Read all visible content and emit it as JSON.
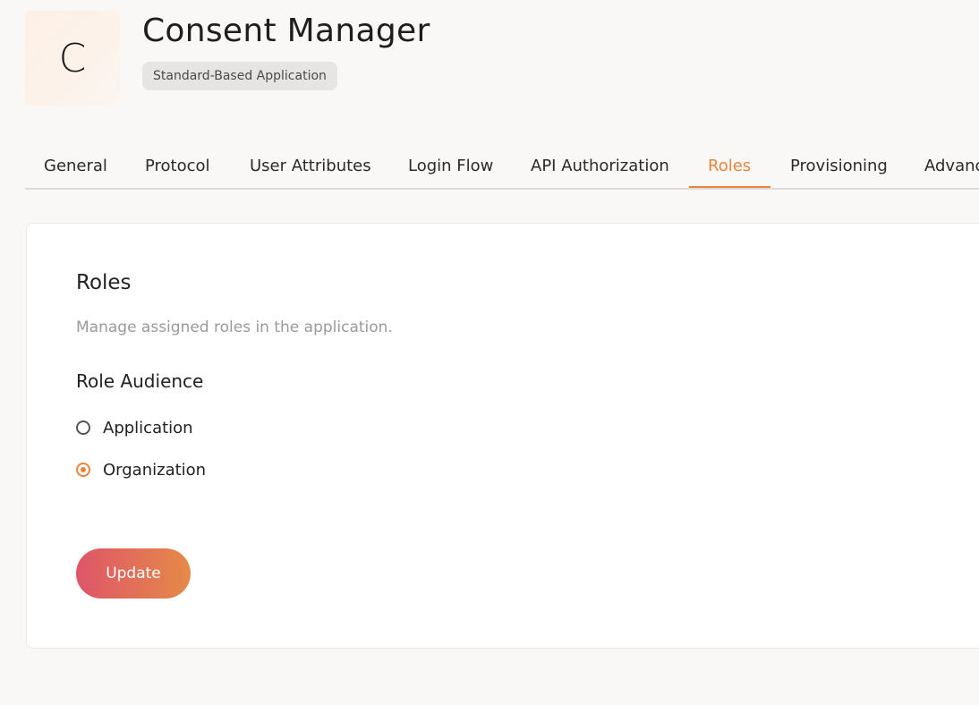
{
  "app": {
    "avatar_letter": "C",
    "title": "Consent Manager",
    "badge": "Standard-Based Application"
  },
  "tabs": [
    {
      "label": "General",
      "active": false
    },
    {
      "label": "Protocol",
      "active": false
    },
    {
      "label": "User Attributes",
      "active": false
    },
    {
      "label": "Login Flow",
      "active": false
    },
    {
      "label": "API Authorization",
      "active": false
    },
    {
      "label": "Roles",
      "active": true
    },
    {
      "label": "Provisioning",
      "active": false
    },
    {
      "label": "Advanced",
      "active": false
    }
  ],
  "roles_section": {
    "title": "Roles",
    "description": "Manage assigned roles in the application.",
    "audience_label": "Role Audience",
    "options": [
      {
        "label": "Application",
        "checked": false
      },
      {
        "label": "Organization",
        "checked": true
      }
    ],
    "update_label": "Update"
  },
  "colors": {
    "accent": "#e8843b",
    "button_gradient_start": "#de5569",
    "button_gradient_end": "#e58a48"
  }
}
